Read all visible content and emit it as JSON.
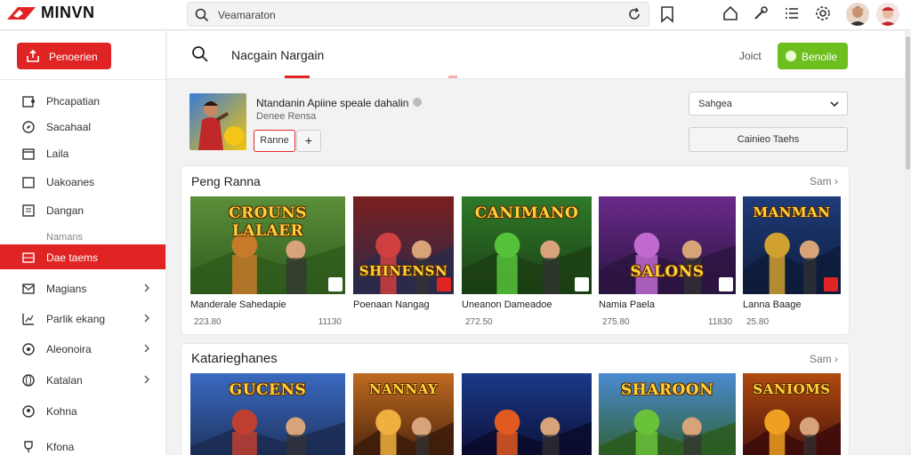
{
  "app": {
    "brand": "MINVN"
  },
  "topbar": {
    "search_text": "Veamaraton"
  },
  "sidebar": {
    "primary_button": "Penoerien",
    "items": [
      {
        "label": "Phcapatian",
        "icon": "puzzle-icon",
        "chevron": false
      },
      {
        "label": "Sacahaal",
        "icon": "compass-icon",
        "chevron": false
      },
      {
        "label": "Laila",
        "icon": "calendar-icon",
        "chevron": false
      },
      {
        "label": "Uakoanes",
        "icon": "box-icon",
        "chevron": false
      },
      {
        "label": "Dangan",
        "icon": "news-icon",
        "chevron": false
      },
      {
        "label": "Namans",
        "icon": "",
        "chevron": false,
        "sub": true
      },
      {
        "label": "Dae taems",
        "icon": "grid-icon",
        "chevron": false,
        "active": true
      },
      {
        "label": "Magians",
        "icon": "mail-icon",
        "chevron": true
      },
      {
        "label": "Parlik ekang",
        "icon": "chart-icon",
        "chevron": true
      },
      {
        "label": "Aleonoira",
        "icon": "settings-icon",
        "chevron": true
      },
      {
        "label": "Katalan",
        "icon": "globe-icon",
        "chevron": true
      },
      {
        "label": "Kohna",
        "icon": "user-icon",
        "chevron": false
      },
      {
        "label": "Kfona",
        "icon": "trophy-icon",
        "chevron": false
      }
    ]
  },
  "header": {
    "title": "Nacgain Nargain",
    "link": "Joict",
    "cta": "Benoile"
  },
  "featured": {
    "title": "Ntandanin Apiine speale dahalin",
    "subtitle": "Denee Rensa",
    "button": "Ranne",
    "plus": "+",
    "select_value": "Sahgea",
    "secondary_button": "Cainieo Taehs"
  },
  "sections": [
    {
      "title": "Peng Ranna",
      "see_all": "Sam",
      "games": [
        {
          "label": "Manderale Sahedapie",
          "left": "223.80",
          "right": "11130",
          "art_title": "CROUNS LALAER"
        },
        {
          "label": "Poenaan Nangag",
          "left": "",
          "right": "",
          "art_title": "SHINENSN"
        },
        {
          "label": "Uneanon Dameadoe",
          "left": "272.50",
          "right": "",
          "art_title": "CANIMANO"
        },
        {
          "label": "Namia Paela",
          "left": "275.80",
          "right": "11830",
          "art_title": "SALONS"
        },
        {
          "label": "Lanna Baage",
          "left": "25.80",
          "right": "",
          "art_title": "MANMAN"
        }
      ]
    },
    {
      "title": "Katarieghanes",
      "see_all": "Sam",
      "games": [
        {
          "art_title": "GUCENS"
        },
        {
          "art_title": "NANNAY"
        },
        {
          "art_title": ""
        },
        {
          "art_title": "SHAROON"
        },
        {
          "art_title": "SANIOMS"
        }
      ]
    }
  ],
  "colors": {
    "accent": "#e02424",
    "cta": "#6cbf1f"
  }
}
